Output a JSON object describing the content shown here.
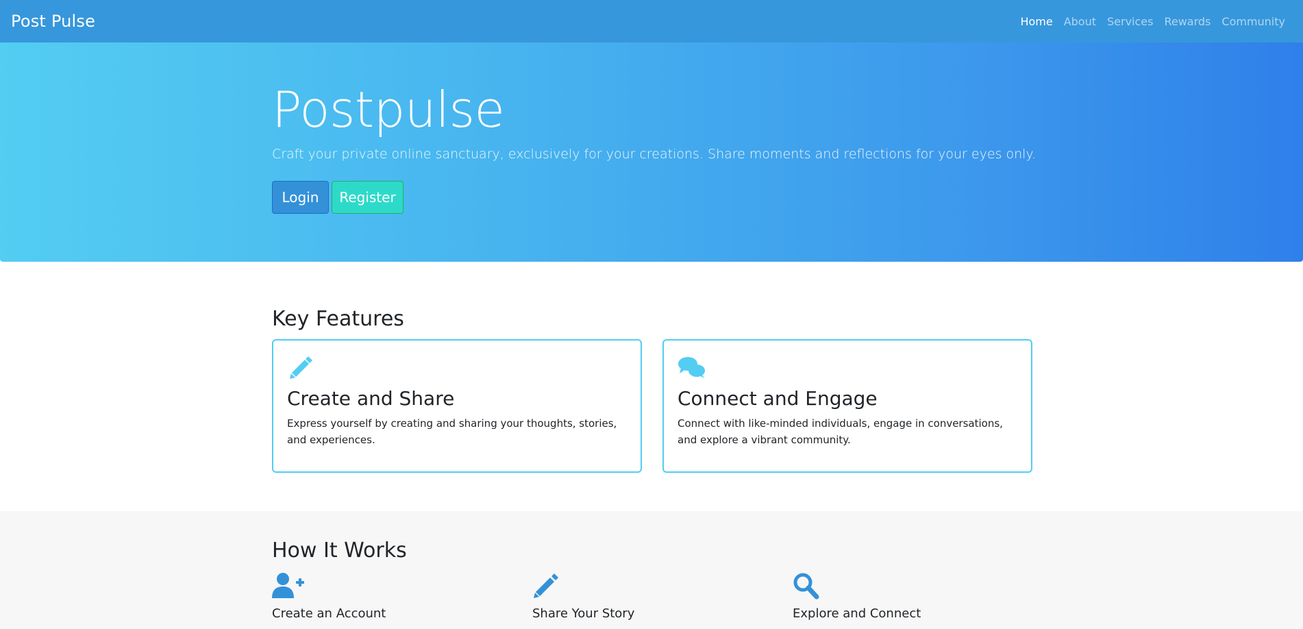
{
  "nav": {
    "brand": "Post Pulse",
    "links": [
      {
        "label": "Home"
      },
      {
        "label": "About"
      },
      {
        "label": "Services"
      },
      {
        "label": "Rewards"
      },
      {
        "label": "Community"
      }
    ]
  },
  "hero": {
    "title": "Postpulse",
    "subtitle": "Craft your private online sanctuary, exclusively for your creations. Share moments and reflections for your eyes only.",
    "login_label": "Login",
    "register_label": "Register"
  },
  "features": {
    "title": "Key Features",
    "cards": [
      {
        "icon": "pencil-icon",
        "title": "Create and Share",
        "text": "Express yourself by creating and sharing your thoughts, stories, and experiences."
      },
      {
        "icon": "comments-icon",
        "title": "Connect and Engage",
        "text": "Connect with like-minded individuals, engage in conversations, and explore a vibrant community."
      }
    ]
  },
  "how": {
    "title": "How It Works",
    "steps": [
      {
        "icon": "user-plus-icon",
        "title": "Create an Account"
      },
      {
        "icon": "pencil-icon",
        "title": "Share Your Story"
      },
      {
        "icon": "search-icon",
        "title": "Explore and Connect"
      }
    ]
  },
  "colors": {
    "navbar": "#3797dc",
    "hero_gradient_start": "#53cdf2",
    "hero_gradient_end": "#2f80ea",
    "card_border": "#53cdf2",
    "feature_icon": "#53cdf2",
    "step_icon": "#3491d8",
    "login_button": "#3491d8",
    "register_button": "#2ddac9"
  }
}
